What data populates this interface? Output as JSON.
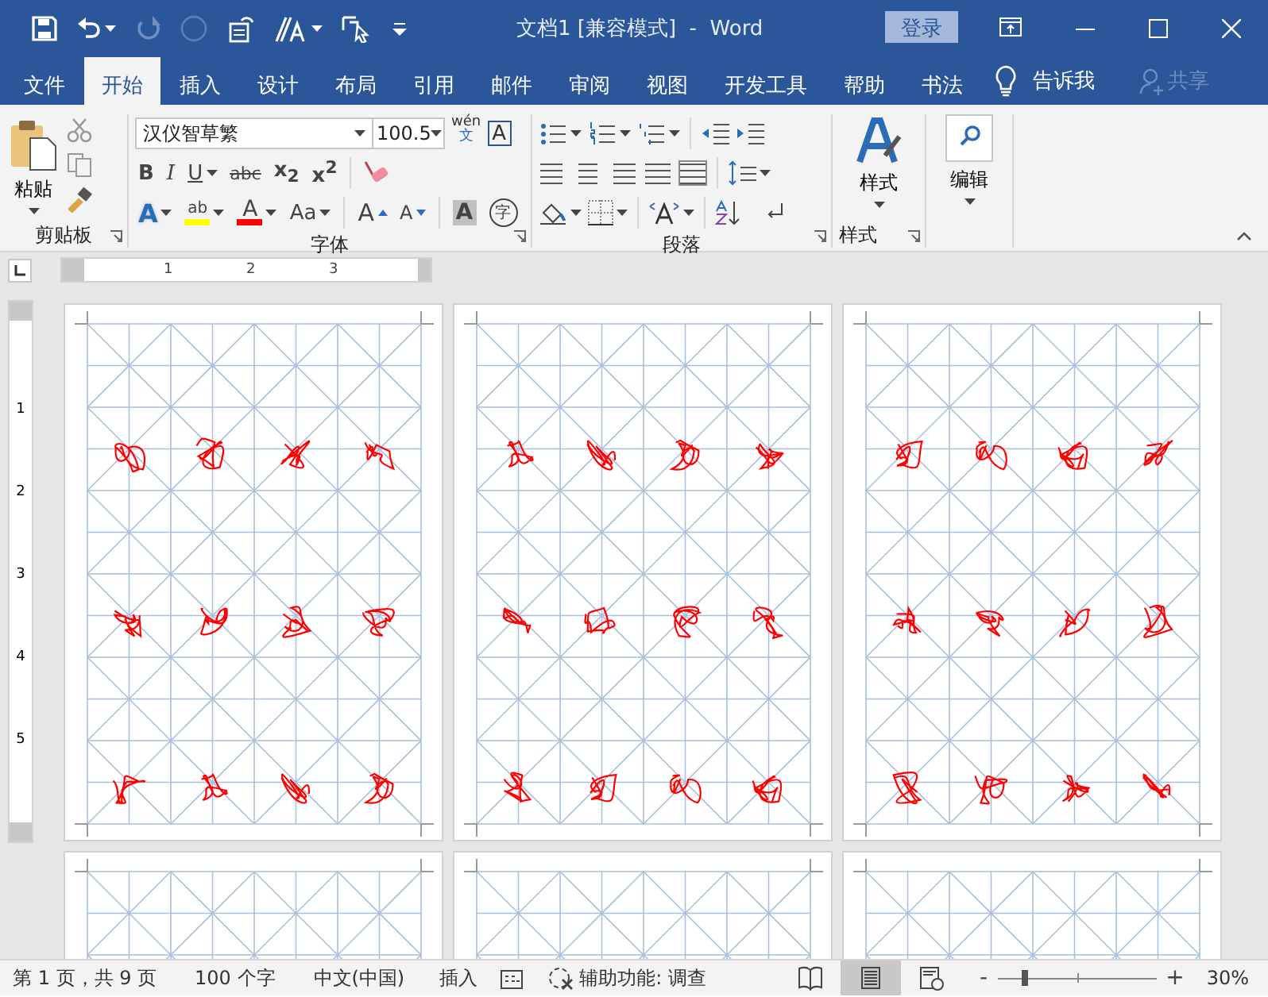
{
  "title_bar": {
    "title": "文档1 [兼容模式]  -  Word",
    "sign_in": "登录"
  },
  "tabs": [
    {
      "label": "文件",
      "selected": false
    },
    {
      "label": "开始",
      "selected": true
    },
    {
      "label": "插入",
      "selected": false
    },
    {
      "label": "设计",
      "selected": false
    },
    {
      "label": "布局",
      "selected": false
    },
    {
      "label": "引用",
      "selected": false
    },
    {
      "label": "邮件",
      "selected": false
    },
    {
      "label": "审阅",
      "selected": false
    },
    {
      "label": "视图",
      "selected": false
    },
    {
      "label": "开发工具",
      "selected": false
    },
    {
      "label": "帮助",
      "selected": false
    },
    {
      "label": "书法",
      "selected": false
    }
  ],
  "tell_me": "告诉我",
  "share": {
    "label": "共享",
    "disabled": true
  },
  "ribbon": {
    "clipboard": {
      "paste": "粘贴",
      "group": "剪贴板"
    },
    "font": {
      "name": "汉仪智草繁",
      "size": "100.5",
      "phonetic_top": "wén",
      "phonetic_bottom": "文",
      "border_char": "A",
      "format_buttons": [
        "B",
        "I",
        "U",
        "abc",
        "x$_{2}$",
        "x$^{2}$"
      ],
      "effect_buttons": [
        {
          "kind": "text-effect",
          "label": "A"
        },
        {
          "kind": "highlight",
          "label": "ab",
          "color": "#ffff00"
        },
        {
          "kind": "font-color",
          "label": "A",
          "color": "#ff0000"
        },
        {
          "kind": "case",
          "label": "Aa"
        },
        {
          "kind": "grow",
          "label": "A"
        },
        {
          "kind": "shrink",
          "label": "A"
        },
        {
          "kind": "shading",
          "label": "A"
        },
        {
          "kind": "enclose",
          "label": "字"
        }
      ],
      "group": "字体"
    },
    "paragraph": {
      "group": "段落"
    },
    "styles": {
      "button": "样式",
      "group": "样式"
    },
    "editing": {
      "button": "编辑"
    }
  },
  "ruler": {
    "h_marks": [
      "1",
      "2",
      "3"
    ],
    "v_marks": [
      "1",
      "2",
      "3",
      "4",
      "5"
    ]
  },
  "status_bar": {
    "page": "第 1 页，共 9 页",
    "words": "100 个字",
    "language": "中文(中国)",
    "mode": "插入",
    "accessibility": "辅助功能: 调查",
    "views": [
      {
        "kind": "read",
        "selected": false
      },
      {
        "kind": "print",
        "selected": true
      },
      {
        "kind": "web",
        "selected": false
      }
    ],
    "zoom_out": "-",
    "zoom_in": "+",
    "zoom": {
      "level": 0.17
    },
    "zoom_percent": "30%"
  }
}
